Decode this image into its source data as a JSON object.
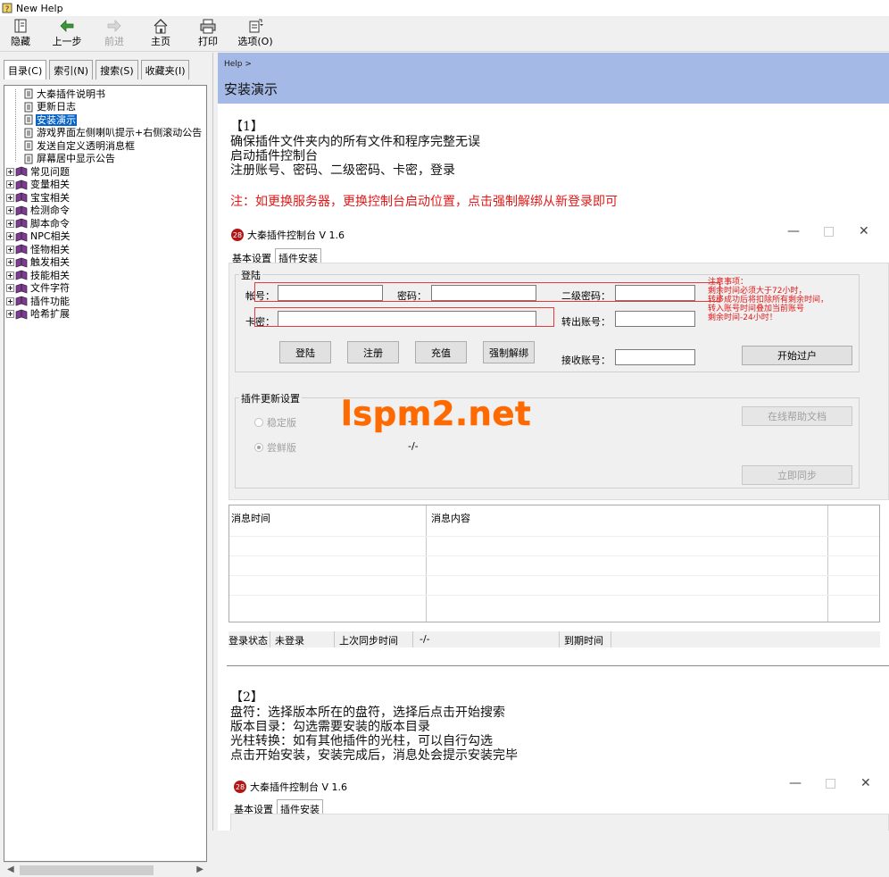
{
  "window": {
    "title": "New Help"
  },
  "toolbar": {
    "hide": "隐藏",
    "back": "上一步",
    "forward": "前进",
    "home": "主页",
    "print": "打印",
    "options": "选项(O)"
  },
  "left_tabs": [
    "目录(C)",
    "索引(N)",
    "搜索(S)",
    "收藏夹(I)"
  ],
  "tree": {
    "pages": [
      "大秦插件说明书",
      "更新日志",
      "安装演示",
      "游戏界面左侧喇叭提示+右侧滚动公告",
      "发送自定义透明消息框",
      "屏幕居中显示公告"
    ],
    "selected_index": 2,
    "books": [
      "常见问题",
      "变量相关",
      "宝宝相关",
      "检测命令",
      "脚本命令",
      "NPC相关",
      "怪物相关",
      "触发相关",
      "技能相关",
      "文件字符",
      "插件功能",
      "哈希扩展"
    ]
  },
  "header": {
    "breadcrumb": "Help >",
    "title": "安装演示"
  },
  "section1": {
    "heading": "【1】",
    "lines": [
      "确保插件文件夹内的所有文件和程序完整无误",
      "启动插件控制台",
      "注册账号、密码、二级密码、卡密，登录"
    ],
    "note": "注：如更换服务器，更换控制台启动位置，点击强制解绑从新登录即可"
  },
  "console": {
    "title": "大秦插件控制台 V 1.6",
    "tabs": [
      "基本设置",
      "插件安装"
    ],
    "login_group": "登陆",
    "labels": {
      "account": "帐号：",
      "password": "密码：",
      "second_password": "二级密码：",
      "card": "卡密：",
      "transfer_out": "转出账号：",
      "receive": "接收账号："
    },
    "buttons": {
      "login": "登陆",
      "register": "注册",
      "recharge": "充值",
      "force_unbind": "强制解绑",
      "start_transfer": "开始过户",
      "online_help": "在线帮助文档",
      "sync_now": "立即同步"
    },
    "notice": [
      "注意事项：",
      "",
      "剩余时间必须大于72小时，",
      "转移成功后将扣除所有剩余时间，",
      "转入账号时间叠加当前账号",
      "剩余时间-24小时！"
    ],
    "update_group": "插件更新设置",
    "radios": [
      "稳定版",
      "尝鲜版"
    ],
    "radio_values": [
      "-/-",
      "-/-"
    ],
    "grid_headers": [
      "消息时间",
      "消息内容"
    ],
    "status": {
      "login_state_label": "登录状态",
      "login_state": "未登录",
      "last_sync_label": "上次同步时间",
      "last_sync": "-/-",
      "expire_label": "到期时间"
    }
  },
  "section2": {
    "heading": "【2】",
    "lines": [
      "盘符：选择版本所在的盘符，选择后点击开始搜索",
      "版本目录：勾选需要安装的版本目录",
      "光柱转换：如有其他插件的光柱，可以自行勾选",
      "点击开始安装，安装完成后，消息处会提示安装完毕"
    ]
  },
  "console2": {
    "title": "大秦插件控制台 V 1.6",
    "tabs": [
      "基本设置",
      "插件安装"
    ]
  },
  "watermark": "lspm2.net",
  "colors": {
    "header_bg": "#a5b9e6",
    "selected": "#0a64c8",
    "red": "#e01818",
    "watermark": "#ff6a00"
  }
}
